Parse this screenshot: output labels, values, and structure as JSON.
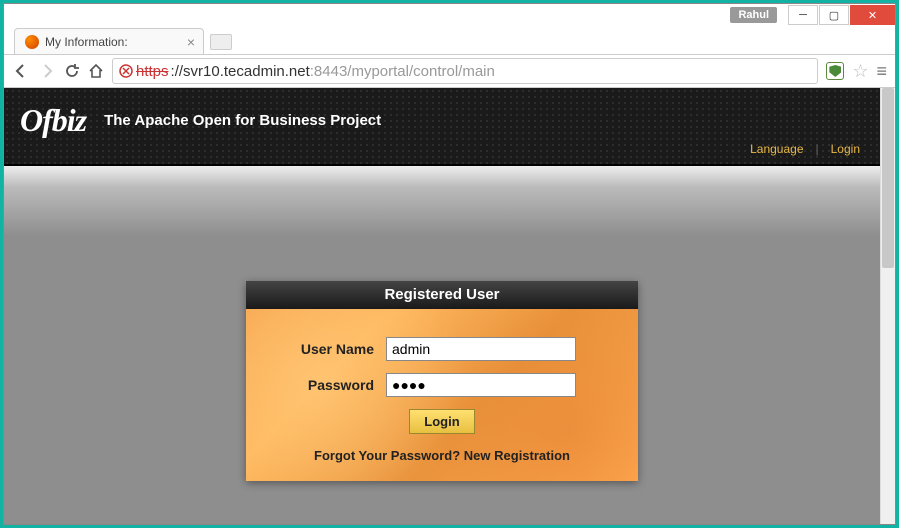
{
  "window": {
    "user_badge": "Rahul"
  },
  "tab": {
    "title": "My Information:"
  },
  "url": {
    "protocol_struck": "https",
    "domain": "://svr10.tecadmin.net",
    "port_path": ":8443/myportal/control/main"
  },
  "header": {
    "logo_text": "Ofbiz",
    "tagline": "The Apache Open for Business Project",
    "language_link": "Language",
    "login_link": "Login"
  },
  "login": {
    "title": "Registered User",
    "username_label": "User Name",
    "username_value": "admin",
    "password_label": "Password",
    "password_value": "●●●●",
    "button": "Login",
    "forgot": "Forgot Your Password?",
    "register": "New Registration"
  }
}
